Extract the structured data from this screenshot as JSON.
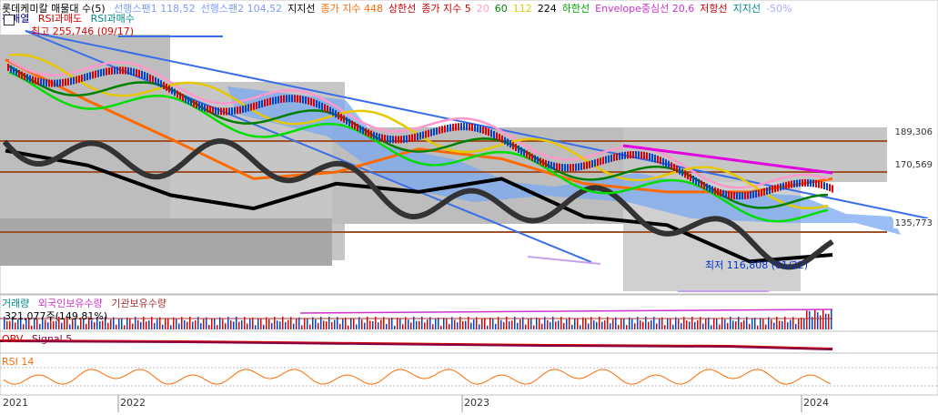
{
  "header": {
    "title": "롯데케미칼 매물대 수(5)",
    "items": [
      {
        "label": "선행스팬1 118,52",
        "color": "#7a9cff"
      },
      {
        "label": "선행스팬2 104,52",
        "color": "#7a9cff"
      },
      {
        "label": "지지선",
        "color": "#000000"
      },
      {
        "label": "종가 지수 448",
        "color": "#ff6a00"
      },
      {
        "label": "상한선",
        "color": "#cc0000"
      },
      {
        "label": "종가 지수 5",
        "color": "#cc0000"
      },
      {
        "label": "20",
        "color": "#ff99cc"
      },
      {
        "label": "60",
        "color": "#008000"
      },
      {
        "label": "112",
        "color": "#e6c800"
      },
      {
        "label": "224",
        "color": "#000000"
      },
      {
        "label": "하한선",
        "color": "#00aa00"
      },
      {
        "label": "Envelope중심선 20,6",
        "color": "#cc33cc"
      },
      {
        "label": "저항선",
        "color": "#cc0000"
      },
      {
        "label": "지지선",
        "color": "#008888"
      },
      {
        "label": "-50%",
        "color": "#aaaaff"
      }
    ],
    "row2": [
      {
        "label": "정배열",
        "color": "#000088"
      },
      {
        "label": "RSI과매도",
        "color": "#cc0000"
      },
      {
        "label": "RSI과매수",
        "color": "#008888"
      }
    ]
  },
  "annotations": {
    "high": "최고 255,746 (09/17)",
    "low": "최저 116,808 (01/22)"
  },
  "price_levels": [
    "189,306",
    "170,569",
    "135,773"
  ],
  "volume_panel": {
    "legend": [
      {
        "label": "거래량",
        "color": "#008888"
      },
      {
        "label": "외국인보유수량",
        "color": "#cc33cc"
      },
      {
        "label": "기관보유수량",
        "color": "#aa3333"
      }
    ],
    "value_text": "321,077주(149.81%)"
  },
  "obv_panel": {
    "legend": [
      {
        "label": "OBV",
        "color": "#cc0000"
      },
      {
        "label": "Signal 5",
        "color": "#880044"
      }
    ]
  },
  "rsi_panel": {
    "legend": [
      {
        "label": "RSI 14",
        "color": "#ff6a00"
      }
    ]
  },
  "x_axis_labels": [
    "2021",
    "2022",
    "2023",
    "2024"
  ],
  "colors": {
    "up": "#e00000",
    "down": "#0044cc",
    "level_line": "#a0522d",
    "trend": "#3a6ee8"
  },
  "chart_data": {
    "type": "line",
    "title": "롯데케미칼",
    "x_ticks": [
      "2021",
      "2022",
      "2023",
      "2024"
    ],
    "price_level_values": [
      189306,
      170569,
      135773
    ],
    "high": {
      "value": 255746,
      "date": "09/17"
    },
    "low": {
      "value": 116808,
      "date": "01/22"
    },
    "series": [
      {
        "name": "224",
        "values": [
          185000,
          176000,
          158000,
          150000,
          165000,
          160000,
          168000,
          145000,
          140000,
          118000,
          122000
        ]
      },
      {
        "name": "종가 지수 448",
        "values": [
          240000,
          215000,
          192000,
          168000,
          172000,
          186000,
          180000,
          165000,
          160000,
          160000,
          168000
        ]
      }
    ]
  }
}
